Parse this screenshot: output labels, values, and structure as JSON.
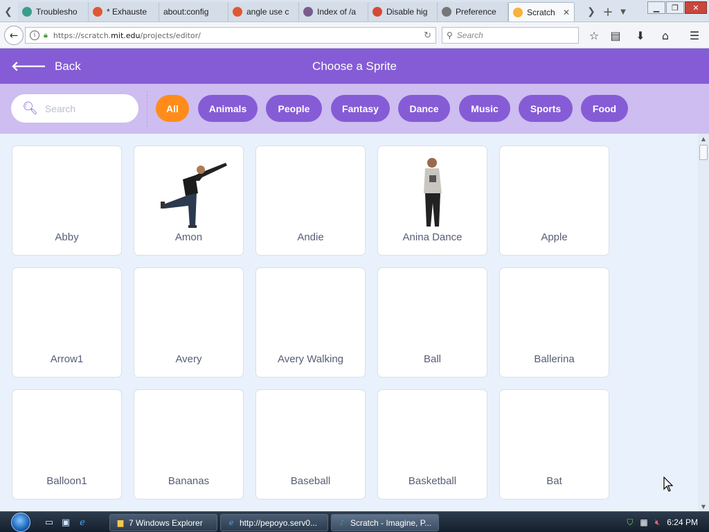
{
  "browser": {
    "tabs": [
      {
        "title": "Troublesho",
        "icon": "troubleshoot-icon",
        "color": "#3a9c8c"
      },
      {
        "title": "* Exhauste",
        "icon": "duckduckgo-icon",
        "color": "#de5833"
      },
      {
        "title": "about:config",
        "icon": "",
        "color": ""
      },
      {
        "title": "angle use c",
        "icon": "duckduckgo-icon",
        "color": "#de5833"
      },
      {
        "title": "Index of /a",
        "icon": "folder-image-icon",
        "color": "#7a5c8c"
      },
      {
        "title": "Disable hig",
        "icon": "firefox-icon",
        "color": "#d54a34"
      },
      {
        "title": "Preference",
        "icon": "gear-icon",
        "color": "#777777"
      },
      {
        "title": "Scratch",
        "icon": "scratch-cat-icon",
        "color": "#f7b23a",
        "active": true
      }
    ],
    "url_prefix": "https://scratch.",
    "url_domain": "mit.edu",
    "url_path": "/projects/editor/",
    "search_placeholder": "Search"
  },
  "header": {
    "back_label": "Back",
    "title": "Choose a Sprite",
    "color": "#855cd6"
  },
  "filters": {
    "search_placeholder": "Search",
    "chips": [
      "All",
      "Animals",
      "People",
      "Fantasy",
      "Dance",
      "Music",
      "Sports",
      "Food"
    ],
    "active": "All",
    "active_color": "#ff8c1a",
    "chip_color": "#855cd6"
  },
  "sprites": [
    "Abby",
    "Amon",
    "Andie",
    "Anina Dance",
    "Apple",
    "Arrow1",
    "Avery",
    "Avery Walking",
    "Ball",
    "Ballerina",
    "Balloon1",
    "Bananas",
    "Baseball",
    "Basketball",
    "Bat"
  ],
  "taskbar": {
    "buttons": [
      "7 Windows Explorer",
      "http://pepoyo.serv0...",
      "Scratch - Imagine, P..."
    ],
    "clock": "6:24 PM"
  }
}
